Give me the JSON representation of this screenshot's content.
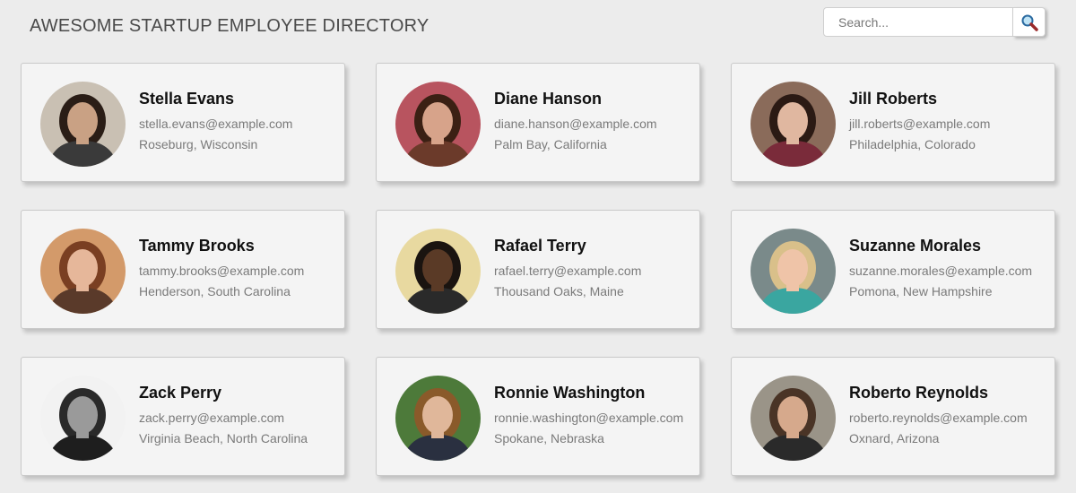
{
  "header": {
    "title": "AWESOME STARTUP EMPLOYEE DIRECTORY",
    "search_placeholder": "Search...",
    "search_icon": "magnifier-icon"
  },
  "employees": [
    {
      "name": "Stella Evans",
      "email": "stella.evans@example.com",
      "location": "Roseburg, Wisconsin",
      "photo": {
        "bg": "#c9c0b3",
        "hair": "#2a1d16",
        "skin": "#c9a184",
        "shirt": "#3a3a3a"
      }
    },
    {
      "name": "Diane Hanson",
      "email": "diane.hanson@example.com",
      "location": "Palm Bay, California",
      "photo": {
        "bg": "#b8545f",
        "hair": "#3b2014",
        "skin": "#d7a38a",
        "shirt": "#6b3a2a"
      }
    },
    {
      "name": "Jill Roberts",
      "email": "jill.roberts@example.com",
      "location": "Philadelphia, Colorado",
      "photo": {
        "bg": "#8a6b5a",
        "hair": "#2b1a14",
        "skin": "#e0b7a0",
        "shirt": "#7a2b3a"
      }
    },
    {
      "name": "Tammy Brooks",
      "email": "tammy.brooks@example.com",
      "location": "Henderson, South Carolina",
      "photo": {
        "bg": "#d39a6a",
        "hair": "#7a3f22",
        "skin": "#e6b79a",
        "shirt": "#5a3a2a"
      }
    },
    {
      "name": "Rafael Terry",
      "email": "rafael.terry@example.com",
      "location": "Thousand Oaks, Maine",
      "photo": {
        "bg": "#e8d9a0",
        "hair": "#1a1410",
        "skin": "#5a3a26",
        "shirt": "#2a2a2a"
      }
    },
    {
      "name": "Suzanne Morales",
      "email": "suzanne.morales@example.com",
      "location": "Pomona, New Hampshire",
      "photo": {
        "bg": "#7a8a8a",
        "hair": "#d9c08a",
        "skin": "#efc4a8",
        "shirt": "#3aa6a0"
      }
    },
    {
      "name": "Zack Perry",
      "email": "zack.perry@example.com",
      "location": "Virginia Beach, North Carolina",
      "photo": {
        "bg": "#f2f2f2",
        "hair": "#2a2a2a",
        "skin": "#9a9a9a",
        "shirt": "#1e1e1e"
      }
    },
    {
      "name": "Ronnie Washington",
      "email": "ronnie.washington@example.com",
      "location": "Spokane, Nebraska",
      "photo": {
        "bg": "#4d7a3a",
        "hair": "#8a5a2a",
        "skin": "#e0b79a",
        "shirt": "#2a3040"
      }
    },
    {
      "name": "Roberto Reynolds",
      "email": "roberto.reynolds@example.com",
      "location": "Oxnard, Arizona",
      "photo": {
        "bg": "#9a9488",
        "hair": "#4a3426",
        "skin": "#d6a98c",
        "shirt": "#2a2a2a"
      }
    }
  ]
}
